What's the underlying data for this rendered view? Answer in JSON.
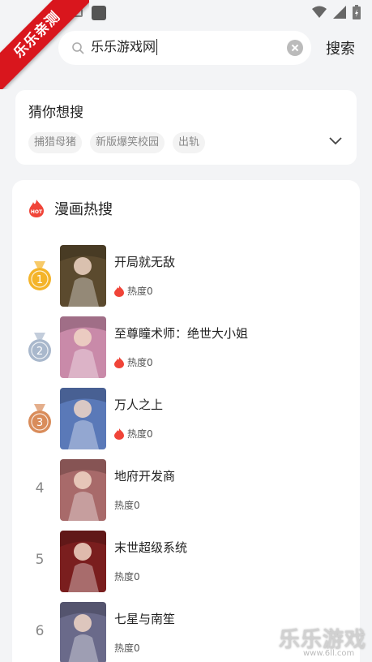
{
  "ribbon": {
    "text": "乐乐亲测"
  },
  "search": {
    "value": "乐乐游戏网",
    "button_label": "搜索"
  },
  "guess": {
    "title": "猜你想搜",
    "tags": [
      "捕猎母猪",
      "新版爆笑校园",
      "出轨"
    ]
  },
  "hot": {
    "title": "漫画热搜",
    "items": [
      {
        "rank": "1",
        "name": "开局就无敌",
        "heat": "热度0",
        "medal": "gold",
        "cover_color": "#5b4a2e"
      },
      {
        "rank": "2",
        "name": "至尊瞳术师：绝世大小姐",
        "heat": "热度0",
        "medal": "silver",
        "cover_color": "#c98aa9"
      },
      {
        "rank": "3",
        "name": "万人之上",
        "heat": "热度0",
        "medal": "bronze",
        "cover_color": "#5a79b8"
      },
      {
        "rank": "4",
        "name": "地府开发商",
        "heat": "热度0",
        "medal": "none",
        "cover_color": "#a86a6a"
      },
      {
        "rank": "5",
        "name": "末世超级系统",
        "heat": "热度0",
        "medal": "none",
        "cover_color": "#7a1e1e"
      },
      {
        "rank": "6",
        "name": "七星与南笙",
        "heat": "热度0",
        "medal": "none",
        "cover_color": "#6a6a8a"
      }
    ]
  },
  "watermark": {
    "brand": "乐乐游戏",
    "url": "www.6ll.com"
  },
  "colors": {
    "accent": "#d9161d",
    "flame": "#f04438",
    "gold": "#f4b42a",
    "silver": "#a9b8cc",
    "bronze": "#d98c5a"
  }
}
